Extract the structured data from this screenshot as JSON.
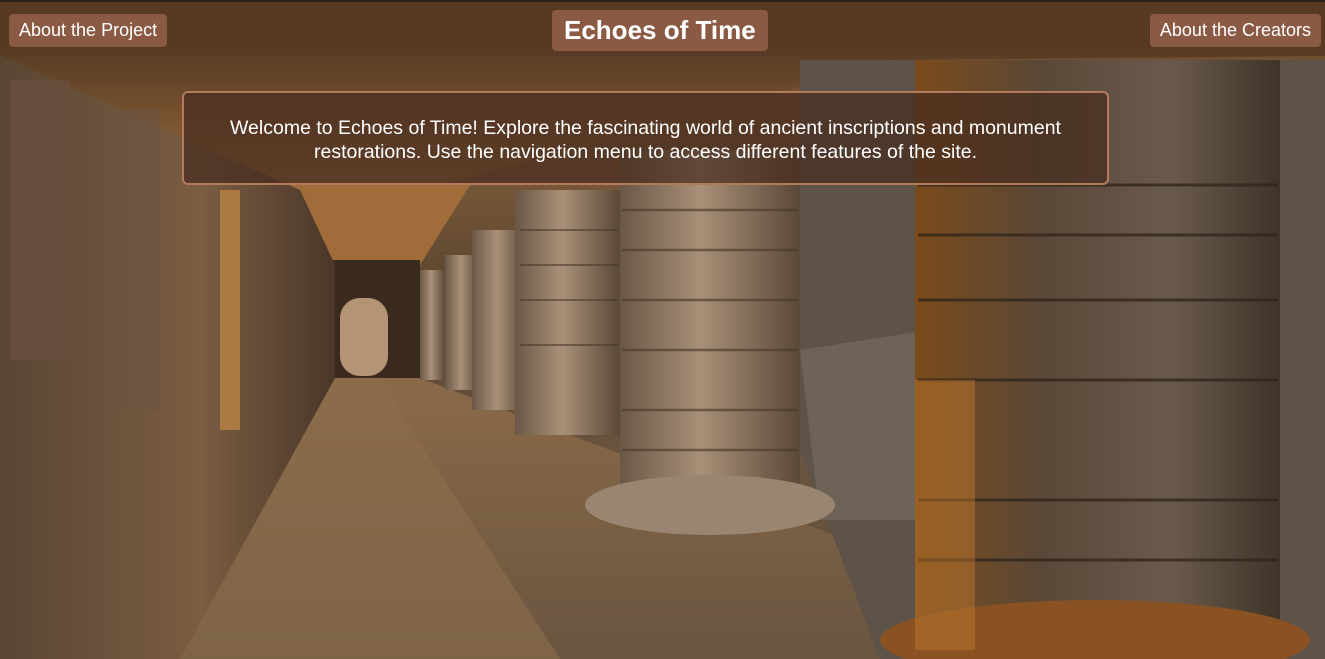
{
  "header": {
    "left_nav_label": "About the Project",
    "title": "Echoes of Time",
    "right_nav_label": "About the Creators"
  },
  "welcome": {
    "message": "Welcome to Echoes of Time! Explore the fascinating world of ancient inscriptions and monument restorations. Use the navigation menu to access different features of the site."
  },
  "colors": {
    "header_bg": "#55372380",
    "button_bg": "#8a5a44",
    "panel_border": "#b37a5c",
    "text": "#ffffff"
  }
}
